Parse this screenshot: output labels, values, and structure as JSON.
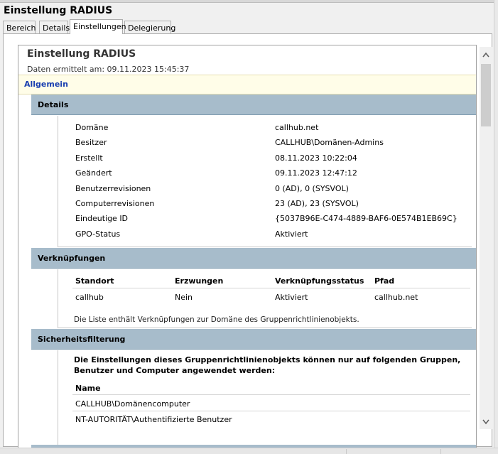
{
  "window": {
    "title": "Einstellung RADIUS"
  },
  "tabs": [
    {
      "label": "Bereich",
      "active": false
    },
    {
      "label": "Details",
      "active": false
    },
    {
      "label": "Einstellungen",
      "active": true
    },
    {
      "label": "Delegierung",
      "active": false
    }
  ],
  "report": {
    "title": "Einstellung RADIUS",
    "date_text": "Daten ermittelt am: 09.11.2023 15:45:37",
    "general_label": "Allgemein",
    "details": {
      "header": "Details",
      "rows": [
        {
          "label": "Domäne",
          "value": "callhub.net"
        },
        {
          "label": "Besitzer",
          "value": "CALLHUB\\Domänen-Admins"
        },
        {
          "label": "Erstellt",
          "value": "08.11.2023 10:22:04"
        },
        {
          "label": "Geändert",
          "value": "09.11.2023 12:47:12"
        },
        {
          "label": "Benutzerrevisionen",
          "value": "0 (AD), 0 (SYSVOL)"
        },
        {
          "label": "Computerrevisionen",
          "value": "23 (AD), 23 (SYSVOL)"
        },
        {
          "label": "Eindeutige ID",
          "value": "{5037B96E-C474-4889-BAF6-0E574B1EB69C}"
        },
        {
          "label": "GPO-Status",
          "value": "Aktiviert"
        }
      ]
    },
    "links": {
      "header": "Verknüpfungen",
      "columns": [
        "Standort",
        "Erzwungen",
        "Verknüpfungsstatus",
        "Pfad"
      ],
      "rows": [
        [
          "callhub",
          "Nein",
          "Aktiviert",
          "callhub.net"
        ]
      ],
      "note": "Die Liste enthält Verknüpfungen zur Domäne des Gruppenrichtlinienobjekts."
    },
    "security": {
      "header": "Sicherheitsfilterung",
      "description": "Die Einstellungen dieses Gruppenrichtlinienobjekts können nur auf folgenden Gruppen, Benutzer und Computer angewendet werden:",
      "column": "Name",
      "rows": [
        "CALLHUB\\Domänencomputer",
        "NT-AUTORITÄT\\Authentifizierte Benutzer"
      ]
    }
  },
  "icons": {
    "scroll_up": "chevron-up-icon",
    "scroll_down": "chevron-down-icon"
  }
}
